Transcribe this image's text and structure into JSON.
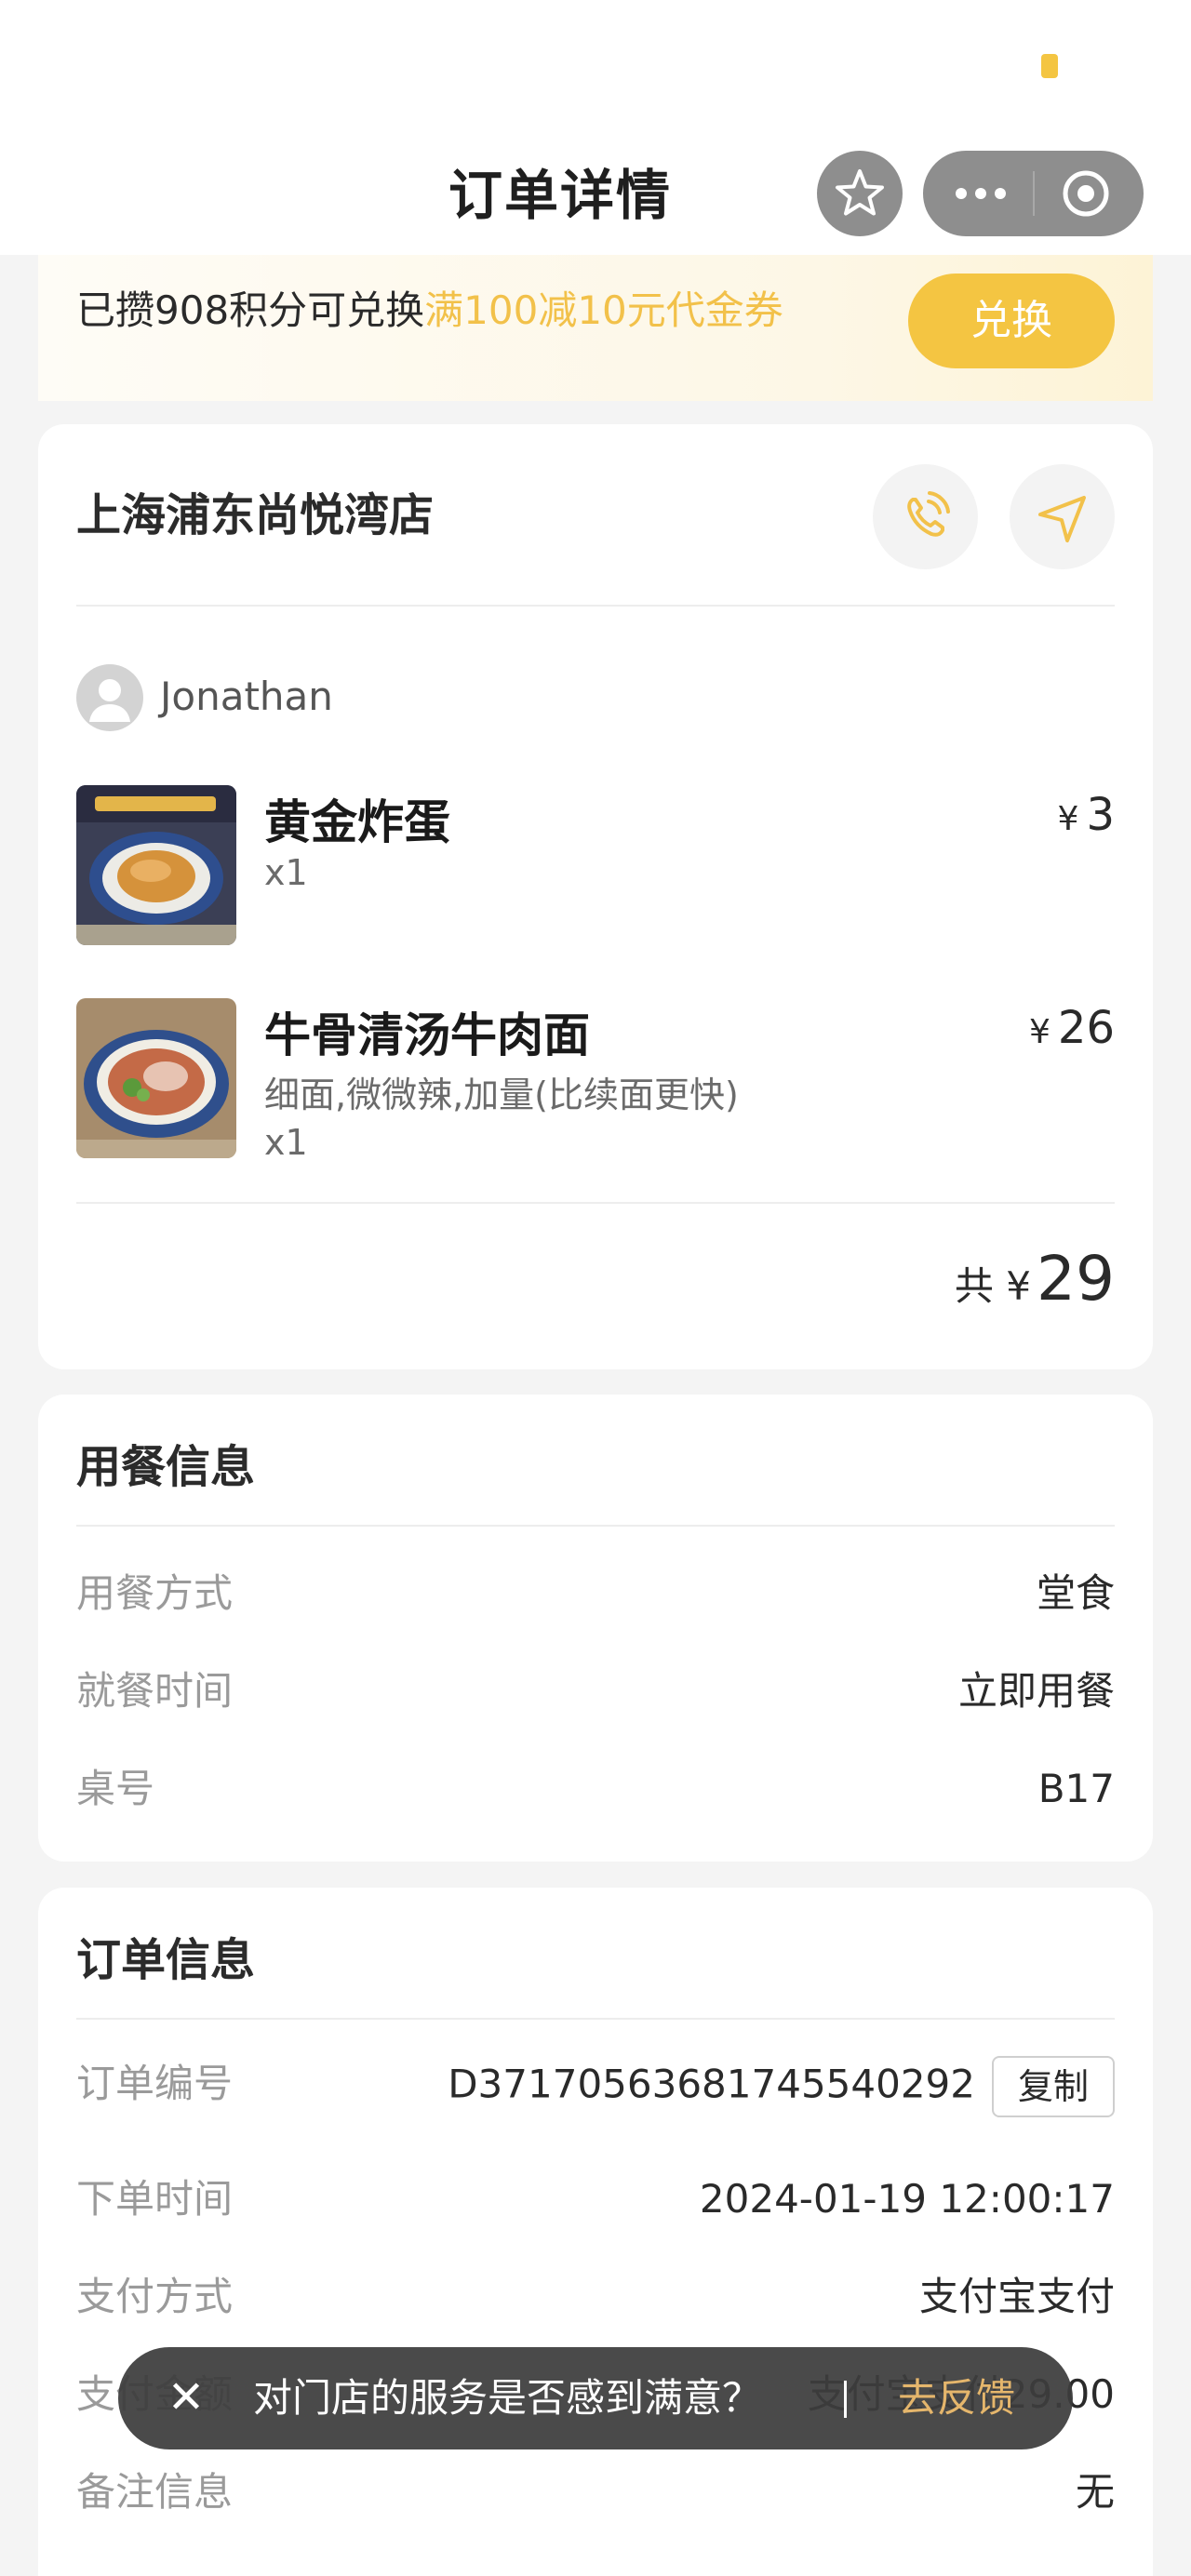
{
  "nav": {
    "title": "订单详情"
  },
  "points_banner": {
    "prefix": "已攒908积分可兑换",
    "highlight": "满100减10元代金券",
    "button_label": "兑换"
  },
  "store": {
    "name": "上海浦东尚悦湾店",
    "user_name": "Jonathan",
    "currency": "¥",
    "items": [
      {
        "name": "黄金炸蛋",
        "options": "",
        "qty": "x1",
        "price": "3"
      },
      {
        "name": "牛骨清汤牛肉面",
        "options": "细面,微微辣,加量(比续面更快)",
        "qty": "x1",
        "price": "26"
      }
    ],
    "total_prefix": "共",
    "total_value": "29"
  },
  "dining_info": {
    "title": "用餐信息",
    "rows": [
      {
        "label": "用餐方式",
        "value": "堂食"
      },
      {
        "label": "就餐时间",
        "value": "立即用餐"
      },
      {
        "label": "桌号",
        "value": "B17"
      }
    ]
  },
  "order_info": {
    "title": "订单信息",
    "order_no_label": "订单编号",
    "order_no": "D37170563681745540292",
    "copy_label": "复制",
    "rows": [
      {
        "label": "下单时间",
        "value": "2024-01-19 12:00:17"
      },
      {
        "label": "支付方式",
        "value": "支付宝支付"
      },
      {
        "label": "支付金额",
        "value": "支付宝支付29.00"
      },
      {
        "label": "备注信息",
        "value": "无"
      }
    ]
  },
  "toast": {
    "message": "对门店的服务是否感到满意？",
    "action": "去反馈"
  },
  "colors": {
    "accent": "#f4c542",
    "highlight_text": "#f2c14a",
    "toast_link": "#e5b66c"
  }
}
